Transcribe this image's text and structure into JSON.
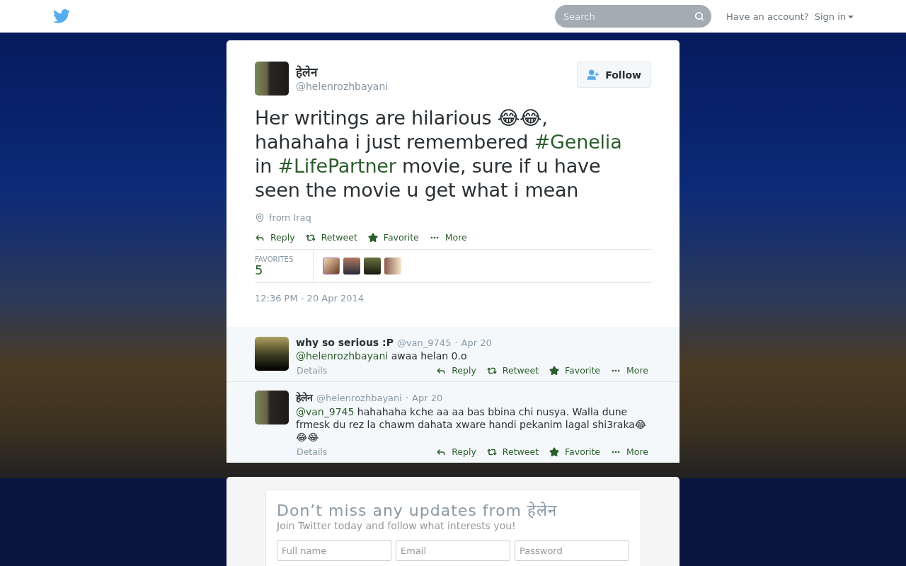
{
  "header": {
    "search": {
      "placeholder": "Search"
    },
    "account_prompt": "Have an account?",
    "sign_in": "Sign in"
  },
  "tweet": {
    "name": "हेलेन",
    "handle": "@helenrozhbayani",
    "follow": "Follow",
    "text": [
      {
        "kind": "text",
        "text": "Her writings are hilarious 😂😂, hahahaha i just remembered "
      },
      {
        "kind": "hashtag",
        "text": "#Genelia"
      },
      {
        "kind": "text",
        "text": " in "
      },
      {
        "kind": "hashtag",
        "text": "#LifePartner"
      },
      {
        "kind": "text",
        "text": " movie, sure if u have seen the movie u get what i mean"
      }
    ],
    "location": "from Iraq",
    "actions": [
      {
        "kind": "reply",
        "label": "Reply"
      },
      {
        "kind": "retweet",
        "label": "Retweet"
      },
      {
        "kind": "favorite",
        "label": "Favorite"
      },
      {
        "kind": "more",
        "label": "More"
      }
    ],
    "stats": {
      "label": "FAVORITES",
      "count": "5"
    },
    "timestamp": "12:36 PM - 20 Apr 2014"
  },
  "replies": [
    {
      "name": "why so serious :P",
      "handle": "@van_9745",
      "separator": "·",
      "date": "Apr 20",
      "mention": "@helenrozhbayani",
      "text": " awaa helan 0.o",
      "details": "Details",
      "actions": [
        {
          "kind": "reply",
          "label": "Reply"
        },
        {
          "kind": "retweet",
          "label": "Retweet"
        },
        {
          "kind": "favorite",
          "label": "Favorite"
        },
        {
          "kind": "more",
          "label": "More"
        }
      ]
    },
    {
      "name": "हेलेन",
      "handle": "@helenrozhbayani",
      "separator": "·",
      "date": "Apr 20",
      "mention": "@van_9745",
      "text": " hahahaha kche aa aa bas bbina chi nusya. Walla dune frmesk du rez la chawm dahata xware handi pekanim lagal shi3raka😂😂😂",
      "details": "Details",
      "actions": [
        {
          "kind": "reply",
          "label": "Reply"
        },
        {
          "kind": "retweet",
          "label": "Retweet"
        },
        {
          "kind": "favorite",
          "label": "Favorite"
        },
        {
          "kind": "more",
          "label": "More"
        }
      ]
    }
  ],
  "signup": {
    "title": "Don’t miss any updates from हेलेन",
    "subtitle": "Join Twitter today and follow what interests you!",
    "fields": [
      {
        "placeholder": "Full name"
      },
      {
        "placeholder": "Email"
      },
      {
        "placeholder": "Password"
      }
    ]
  }
}
